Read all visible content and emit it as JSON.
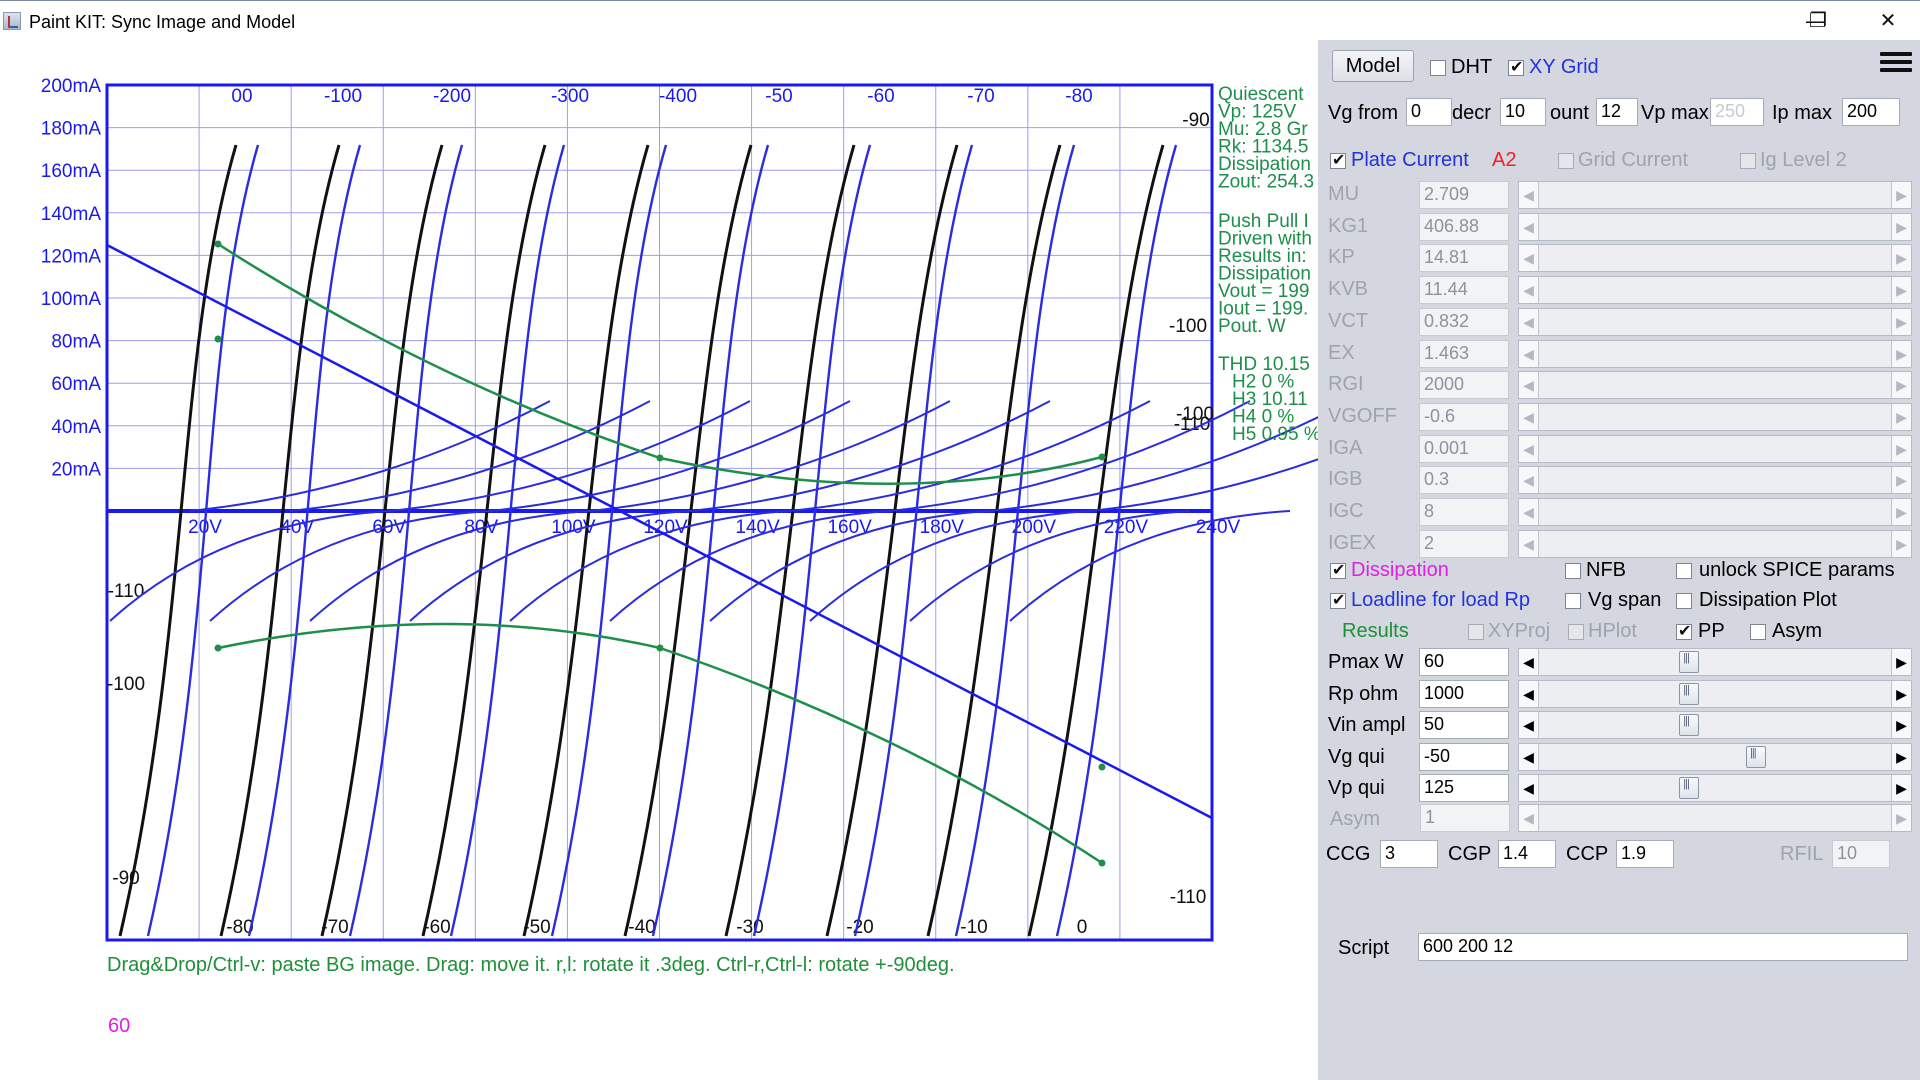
{
  "window": {
    "title": "Paint KIT: Sync Image and Model",
    "minimize_glyph": "—",
    "restore_glyph": "❐",
    "close_glyph": "✕"
  },
  "plot": {
    "y_ticks_upper": [
      "200mA",
      "180mA",
      "160mA",
      "140mA",
      "120mA",
      "100mA",
      "80mA",
      "60mA",
      "40mA",
      "20mA"
    ],
    "x_ticks": [
      "20V",
      "40V",
      "60V",
      "80V",
      "100V",
      "120V",
      "140V",
      "160V",
      "180V",
      "200V",
      "220V",
      "240V"
    ],
    "top_grid_labels": [
      "00",
      "-100",
      "-200",
      "-300",
      "-400",
      "-50",
      "-60",
      "-70",
      "-80"
    ],
    "bottom_grid_labels": [
      "-80",
      "-70",
      "-60",
      "-50",
      "-40",
      "-30",
      "-20",
      "-10",
      "0"
    ],
    "left_side_labels": [
      "-110",
      "-100",
      "-90"
    ],
    "right_side_labels": [
      "-90",
      "-100",
      "-100",
      "-110",
      "-110"
    ],
    "info_lines_1": [
      "Quiescent",
      "Vp: 125V",
      "Mu: 2.8 Gr",
      "Rk: 1134.5",
      "Dissipation",
      "Zout: 254.3"
    ],
    "info_lines_2": [
      "Push Pull I",
      "Driven with",
      "Results in:",
      "Dissipation",
      "Vout = 199",
      "Iout = 199.",
      "Pout. W"
    ],
    "thd_lines": [
      "THD 10.15",
      "H2 0 %",
      "H3 10.11",
      "H4 0 %",
      "H5 0.95 %"
    ],
    "hint": "Drag&Drop/Ctrl-v: paste BG image. Drag: move it. r,l: rotate it .3deg. Ctrl-r,Ctrl-l: rotate +-90deg.",
    "bottom_value": "60",
    "colors": {
      "grid": "#9e9ef0",
      "axis": "#1a1aee",
      "curve_blue": "#2b2be0",
      "curve_black": "#111111",
      "dissipation": "#1e8f4a"
    }
  },
  "panel": {
    "model_button": "Model",
    "dht_label": "DHT",
    "dht_checked": false,
    "xygrid_label": "XY Grid",
    "xygrid_checked": true,
    "vg_from_label": "Vg from",
    "vg_from_value": "0",
    "decr_label": "decr",
    "decr_value": "10",
    "count_label": "ount",
    "count_value": "12",
    "vpmax_label": "Vp max",
    "vpmax_value": "250",
    "ipmax_label": "Ip max",
    "ipmax_value": "200",
    "plate_current_label": "Plate Current",
    "plate_current_checked": true,
    "a2_label": "A2",
    "grid_current_label": "Grid Current",
    "ig_level2_label": "Ig Level 2",
    "params": [
      {
        "name": "MU",
        "value": "2.709"
      },
      {
        "name": "KG1",
        "value": "406.88"
      },
      {
        "name": "KP",
        "value": "14.81"
      },
      {
        "name": "KVB",
        "value": "11.44"
      },
      {
        "name": "VCT",
        "value": "0.832"
      },
      {
        "name": "EX",
        "value": "1.463"
      },
      {
        "name": "RGI",
        "value": "2000"
      },
      {
        "name": "VGOFF",
        "value": "-0.6"
      },
      {
        "name": "IGA",
        "value": "0.001"
      },
      {
        "name": "IGB",
        "value": "0.3"
      },
      {
        "name": "IGC",
        "value": "8"
      },
      {
        "name": "IGEX",
        "value": "2"
      }
    ],
    "dissipation_label": "Dissipation",
    "nfb_label": "NFB",
    "unlock_label": "unlock SPICE params",
    "loadline_label": "Loadline for load Rp",
    "vgspan_label": "Vg span",
    "dissplot_label": "Dissipation Plot",
    "results_label": "Results",
    "xyproj_label": "XYProj",
    "hplot_label": "HPlot",
    "pp_label": "PP",
    "asym_cb_label": "Asym",
    "controls": [
      {
        "name": "Pmax W",
        "value": "60",
        "level": 0.42
      },
      {
        "name": "Rp ohm",
        "value": "1000",
        "level": 0.42
      },
      {
        "name": "Vin ampl",
        "value": "50",
        "level": 0.42
      },
      {
        "name": "Vg qui",
        "value": "-50",
        "level": 0.62
      },
      {
        "name": "Vp qui",
        "value": "125",
        "level": 0.42
      }
    ],
    "asym_label": "Asym",
    "asym_value": "1",
    "ccg_label": "CCG",
    "ccg_value": "3",
    "cgp_label": "CGP",
    "cgp_value": "1.4",
    "ccp_label": "CCP",
    "ccp_value": "1.9",
    "rfil_label": "RFIL",
    "rfil_value": "10",
    "script_label": "Script",
    "script_value": "600 200 12"
  }
}
